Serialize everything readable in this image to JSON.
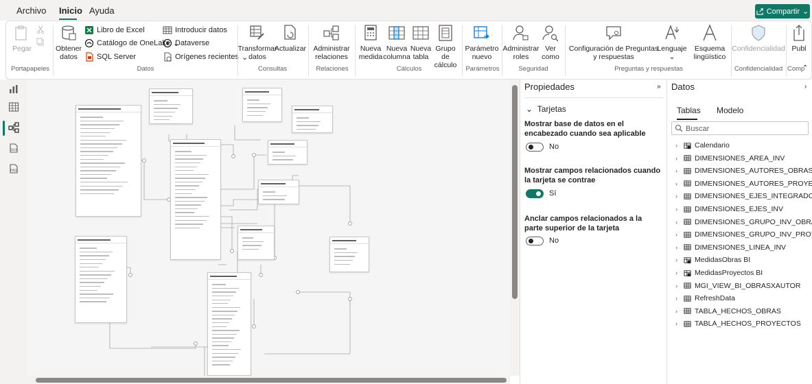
{
  "menu": {
    "items": [
      "Archivo",
      "Inicio",
      "Ayuda"
    ],
    "share_label": "Compartir"
  },
  "ribbon": {
    "pegar": "Pegar",
    "portapapeles": "Portapapeles",
    "obtener_datos": "Obtener datos",
    "libro_excel": "Libro de Excel",
    "onelake": "Catálogo de OneLake",
    "sql_server": "SQL Server",
    "introducir_datos": "Introducir datos",
    "dataverse": "Dataverse",
    "origenes_recientes": "Orígenes recientes",
    "datos": "Datos",
    "transformar_datos": "Transformar datos",
    "actualizar": "Actualizar",
    "consultas": "Consultas",
    "administrar_relaciones": "Administrar relaciones",
    "relaciones": "Relaciones",
    "nueva_medida": "Nueva medida",
    "nueva_columna": "Nueva columna",
    "nueva_tabla": "Nueva tabla",
    "grupo_calculo": "Grupo de cálculo",
    "calculos": "Cálculos",
    "parametro_nuevo": "Parámetro nuevo",
    "parametros": "Parámetros",
    "administrar_roles": "Administrar roles",
    "ver_como": "Ver como",
    "seguridad": "Seguridad",
    "config_preguntas": "Configuración de Preguntas y respuestas",
    "lenguaje": "Lenguaje",
    "esquema_linguistico": "Esquema lingüístico",
    "preguntas_respuestas": "Preguntas y respuestas",
    "confidencialidad_btn": "Confidencialidad",
    "confidencialidad": "Confidencialidad",
    "publicar": "Publ",
    "compartir_grp": "Comp"
  },
  "properties": {
    "title": "Propiedades",
    "section": "Tarjetas",
    "items": [
      {
        "label": "Mostrar base de datos en el encabezado cuando sea aplicable",
        "state": "No",
        "on": false
      },
      {
        "label": "Mostrar campos relacionados cuando la tarjeta se contrae",
        "state": "Sí",
        "on": true
      },
      {
        "label": "Anclar campos relacionados a la parte superior de la tarjeta",
        "state": "No",
        "on": false
      }
    ]
  },
  "data": {
    "title": "Datos",
    "tabs": [
      "Tablas",
      "Modelo"
    ],
    "search_placeholder": "Buscar",
    "tables": [
      {
        "name": "Calendario",
        "kind": "calc"
      },
      {
        "name": "DIMENSIONES_AREA_INV",
        "kind": "table"
      },
      {
        "name": "DIMENSIONES_AUTORES_OBRAS",
        "kind": "table"
      },
      {
        "name": "DIMENSIONES_AUTORES_PROYECTOS",
        "kind": "table"
      },
      {
        "name": "DIMENSIONES_EJES_INTEGRADORES",
        "kind": "table"
      },
      {
        "name": "DIMENSIONES_EJES_INV",
        "kind": "table"
      },
      {
        "name": "DIMENSIONES_GRUPO_INV_OBRAS",
        "kind": "table"
      },
      {
        "name": "DIMENSIONES_GRUPO_INV_PROY",
        "kind": "table"
      },
      {
        "name": "DIMENSIONES_LINEA_INV",
        "kind": "table"
      },
      {
        "name": "MedidasObras BI",
        "kind": "calc"
      },
      {
        "name": "MedidasProyectos BI",
        "kind": "calc"
      },
      {
        "name": "MGI_VIEW_BI_OBRASXAUTOR",
        "kind": "table"
      },
      {
        "name": "RefreshData",
        "kind": "table"
      },
      {
        "name": "TABLA_HECHOS_OBRAS",
        "kind": "table"
      },
      {
        "name": "TABLA_HECHOS_PROYECTOS",
        "kind": "table"
      }
    ]
  },
  "colors": {
    "accent": "#117865",
    "canvas": "#f5f5f5",
    "line": "#a8a6a4"
  }
}
